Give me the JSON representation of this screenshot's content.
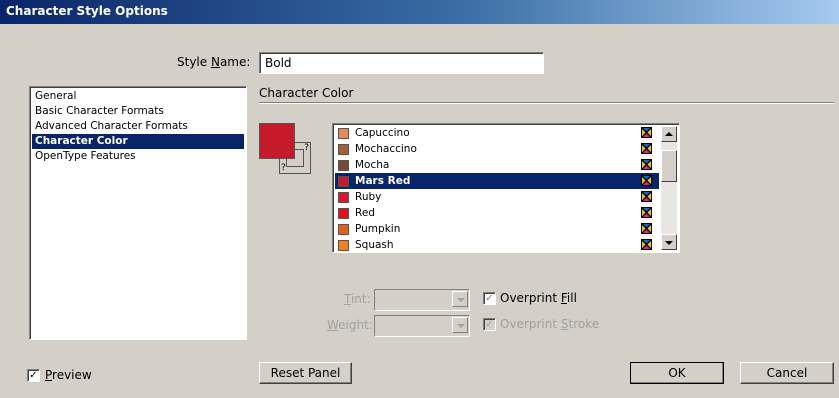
{
  "window": {
    "title": "Character Style Options"
  },
  "style_name": {
    "label_pre": "Style ",
    "label_mnemonic": "N",
    "label_post": "ame:",
    "value": "Bold"
  },
  "categories": [
    {
      "label": "General",
      "selected": false
    },
    {
      "label": "Basic Character Formats",
      "selected": false
    },
    {
      "label": "Advanced Character Formats",
      "selected": false
    },
    {
      "label": "Character Color",
      "selected": true
    },
    {
      "label": "OpenType Features",
      "selected": false
    }
  ],
  "section": {
    "title": "Character Color"
  },
  "fill_stroke": {
    "fill_color": "#c41a2a",
    "stroke_glyph": "?"
  },
  "swatches": [
    {
      "name": "Capuccino",
      "color": "#e08a60",
      "selected": false
    },
    {
      "name": "Mochaccino",
      "color": "#a0603a",
      "selected": false
    },
    {
      "name": "Mocha",
      "color": "#7a4a32",
      "selected": false
    },
    {
      "name": "Mars Red",
      "color": "#c41a2a",
      "selected": true
    },
    {
      "name": "Ruby",
      "color": "#d81830",
      "selected": false
    },
    {
      "name": "Red",
      "color": "#e01020",
      "selected": false
    },
    {
      "name": "Pumpkin",
      "color": "#e06020",
      "selected": false
    },
    {
      "name": "Squash",
      "color": "#f08020",
      "selected": false
    }
  ],
  "tint": {
    "label_mnemonic": "T",
    "label_post": "int:",
    "value": ""
  },
  "weight": {
    "label_mnemonic": "W",
    "label_post": "eight:",
    "value": ""
  },
  "overprint_fill": {
    "label_pre": "Overprint ",
    "label_mnemonic": "F",
    "label_post": "ill",
    "checked": true,
    "enabled": true
  },
  "overprint_stroke": {
    "label_pre": "Overprint ",
    "label_mnemonic": "S",
    "label_post": "troke",
    "checked": true,
    "enabled": false
  },
  "preview": {
    "label_mnemonic": "P",
    "label_post": "review",
    "checked": true
  },
  "buttons": {
    "reset": "Reset Panel",
    "ok": "OK",
    "cancel": "Cancel"
  }
}
